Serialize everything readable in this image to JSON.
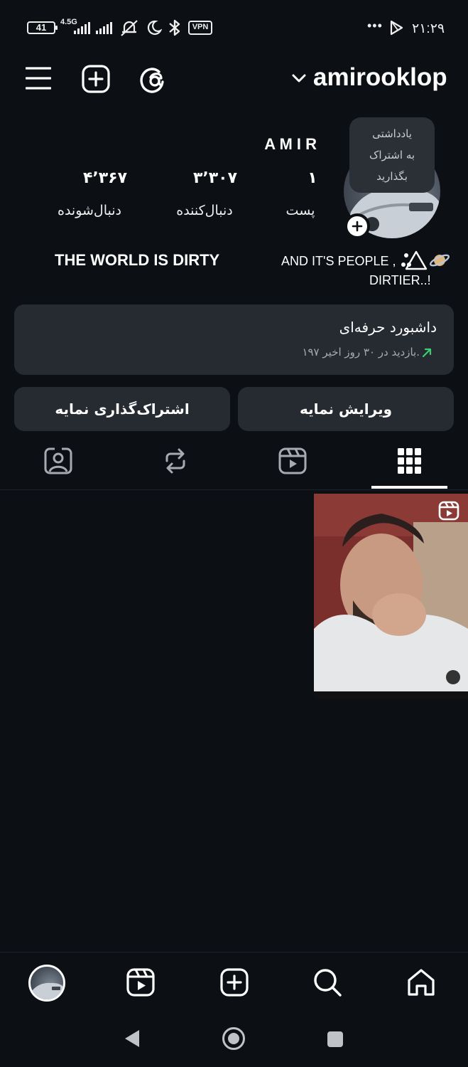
{
  "status_bar": {
    "battery": "41",
    "network": "4.5G",
    "vpn": "VPN",
    "more": "•••",
    "time": "۲۱:۲۹"
  },
  "header": {
    "username": "amirooklop",
    "icons": [
      "menu-icon",
      "create-post-icon",
      "threads-icon",
      "chevron-down-icon"
    ]
  },
  "profile": {
    "name": "A M I R",
    "note_bubble": [
      "یادداشتی",
      "به اشتراک",
      "بگذارید"
    ],
    "stats": [
      {
        "value": "۱",
        "label": "پست"
      },
      {
        "value": "۳٬۳۰۷",
        "label": "دنبال‌کننده"
      },
      {
        "value": "۴٬۳۶۷",
        "label": "دنبال‌شونده"
      }
    ],
    "bio_left": "THE WORLD IS DIRTY",
    "bio_right_line1": "AND IT'S PEOPLE ,",
    "bio_right_line2": "DIRTIER..!"
  },
  "dashboard": {
    "title": "داشبورد حرفه‌ای",
    "subtitle": "۱۹۷ بازدید در ۳۰ روز اخیر.",
    "accent": "#3ccf71"
  },
  "actions": {
    "share_profile": "اشتراک‌گذاری نمایه",
    "edit_profile": "ویرایش نمایه"
  },
  "tabs": [
    "tagged-icon",
    "reposts-icon",
    "reels-icon",
    "grid-icon"
  ],
  "bottom_nav": [
    "profile-avatar",
    "reels-icon",
    "create-icon",
    "search-icon",
    "home-icon"
  ],
  "system_nav": [
    "back-icon",
    "home-icon",
    "recents-icon"
  ]
}
